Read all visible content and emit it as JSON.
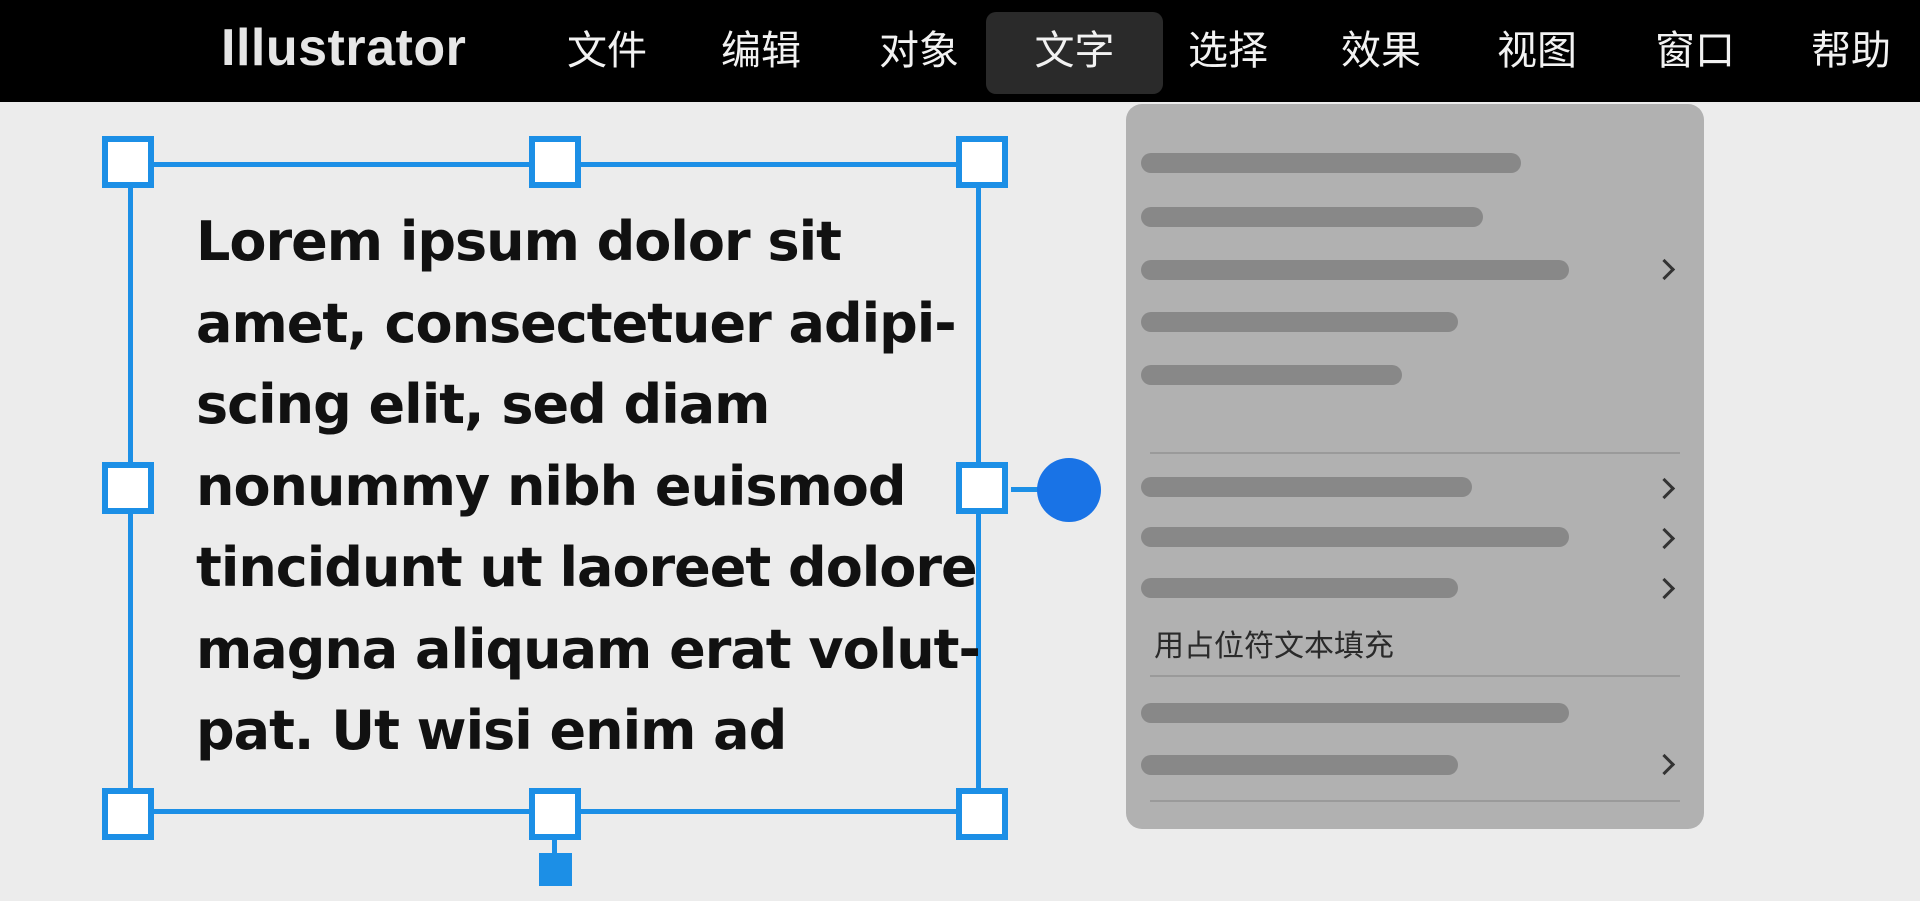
{
  "menubar": {
    "app_name": "Illustrator",
    "items": [
      {
        "label": "文件"
      },
      {
        "label": "编辑"
      },
      {
        "label": "对象"
      },
      {
        "label": "文字",
        "active": true
      },
      {
        "label": "选择"
      },
      {
        "label": "效果"
      },
      {
        "label": "视图"
      },
      {
        "label": "窗口"
      },
      {
        "label": "帮助"
      }
    ]
  },
  "text_frame": {
    "lines": [
      "Lorem ipsum dolor sit",
      "amet, consectetuer adipi-",
      "scing elit, sed diam",
      "nonummy nibh euismod",
      "tincidunt ut laoreet dolore",
      "magna aliquam erat volut-",
      "pat. Ut wisi enim ad"
    ]
  },
  "type_menu": {
    "fill_placeholder_label": "用占位符文本填充"
  },
  "colors": {
    "selection_blue": "#1c8fe6",
    "port_blue": "#1973e6",
    "menubar_bg": "#000000",
    "canvas_bg": "#ececec",
    "dropdown_bg": "#b1b1b1"
  }
}
